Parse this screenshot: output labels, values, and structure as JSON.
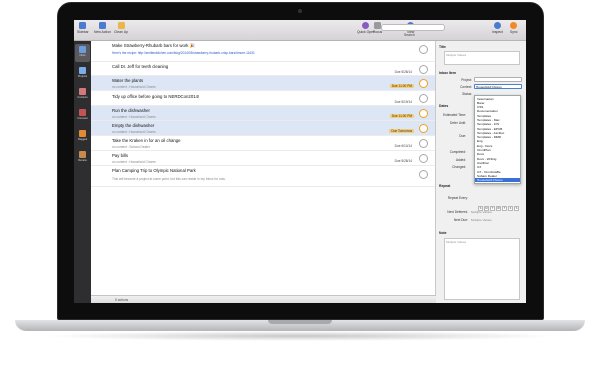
{
  "toolbar": {
    "items": [
      {
        "label": "Sidebar",
        "icon": "sidebar-icon",
        "color": "#4a7bd0"
      },
      {
        "label": "New Action",
        "icon": "plus-icon",
        "color": "#4a7bd0"
      },
      {
        "label": "Clean Up",
        "icon": "broom-icon",
        "color": "#e8b64a"
      }
    ],
    "right_items": [
      {
        "label": "Quick Open",
        "icon": "quick-open-icon",
        "color": "#8a5bc2"
      },
      {
        "label": "Focus",
        "icon": "focus-icon",
        "color": "#9a9a9a"
      },
      {
        "label": "View",
        "icon": "eye-icon",
        "color": "#4a7bd0"
      },
      {
        "label": "Inspect",
        "icon": "info-icon",
        "color": "#4a7bd0"
      },
      {
        "label": "Sync",
        "icon": "sync-icon",
        "color": "#f08a22"
      }
    ],
    "search_label": "Search"
  },
  "sidebar": {
    "items": [
      {
        "label": "Inbox",
        "icon": "inbox-icon",
        "color": "#6a9ce0"
      },
      {
        "label": "Projects",
        "icon": "projects-icon",
        "color": "#7aaee8"
      },
      {
        "label": "Contexts",
        "icon": "contexts-icon",
        "color": "#d27a7a"
      },
      {
        "label": "Forecast",
        "icon": "forecast-icon",
        "color": "#c45454"
      },
      {
        "label": "Flagged",
        "icon": "flag-icon",
        "color": "#e08a34"
      },
      {
        "label": "Review",
        "icon": "review-icon",
        "color": "#c78a4a"
      }
    ]
  },
  "actions": [
    {
      "title": "Make Strawberry-Rhubarb bars for work 🎉",
      "note": "Here's the recipe:  http://smittenkitchen.com/blog/2014/05/strawberry-rhubarb-crisp-bars/#more-11631",
      "due": "",
      "selected": false
    },
    {
      "title": "Call Dr. Jeff for teeth cleaning",
      "note": "",
      "due": "Due 5/28/14",
      "selected": false
    },
    {
      "title": "Water the plants",
      "note": "no context : Household Chores",
      "due": "Due 11:00 PM",
      "selected": true,
      "soon": true
    },
    {
      "title": "Tidy up office before going to NERDCon2014!",
      "note": "",
      "due": "Due 5/19/14",
      "selected": false
    },
    {
      "title": "Run the dishwasher",
      "note": "no context : Household Chores",
      "due": "Due 11:00 PM",
      "selected": true,
      "soon": true
    },
    {
      "title": "Empty the dishwasher",
      "note": "no context : Household Chores",
      "due": "Due Tomorrow",
      "selected": true,
      "soon": true
    },
    {
      "title": "Take the Kraken in for an oil change",
      "note": "no context : Subaru Dealer",
      "due": "Due 6/10/14",
      "selected": false
    },
    {
      "title": "Pay bills",
      "note": "no context : Household Chores",
      "due": "Due 5/28/14",
      "selected": false
    },
    {
      "title": "Plan Camping Trip to Olympic National Park",
      "note": "This will become a project at some point, but this can reside in my Inbox for now.",
      "due": "",
      "selected": false
    }
  ],
  "footer": {
    "count": "5 actions"
  },
  "inspector": {
    "title_section": "Title",
    "title_placeholder": "Multiple Values",
    "inbox_section": "Inbox Item",
    "project_label": "Project:",
    "context_label": "Context:",
    "context_value": "Household Chores",
    "status_label": "Status:",
    "dates_section": "Dates",
    "estimated_label": "Estimated Time:",
    "defer_label": "Defer Until:",
    "due_label": "Due:",
    "completed_label": "Completed:",
    "added_label": "Added:",
    "changed_label": "Changed:",
    "repeat_section": "Repeat",
    "repeat_every_label": "Repeat Every:",
    "days": [
      "S",
      "M",
      "T",
      "W",
      "T",
      "F",
      "S"
    ],
    "next_deferred_label": "Next Deferred:",
    "next_deferred_value": "Multiple Values",
    "next_due_label": "Next Due:",
    "next_due_value": "Multiple Values",
    "note_section": "Note",
    "note_placeholder": "Multiple Values"
  },
  "context_menu": {
    "items": [
      "Veterinarian",
      "Barer",
      "CSS",
      "Documentation",
      "Templates",
      "Templates - Mac",
      "Templates - iOS",
      "Templates - EPUB",
      "Templates - AscDoc",
      "Templates - MMD",
      "Eng",
      "Eng - Docs",
      "OmniPlan",
      "Docs",
      "Docs - Writing",
      "AsciiDoc",
      "UX",
      "UX - OmniGraffle",
      "Subaru Dealer",
      "Household Chores"
    ],
    "highlighted": 19
  }
}
